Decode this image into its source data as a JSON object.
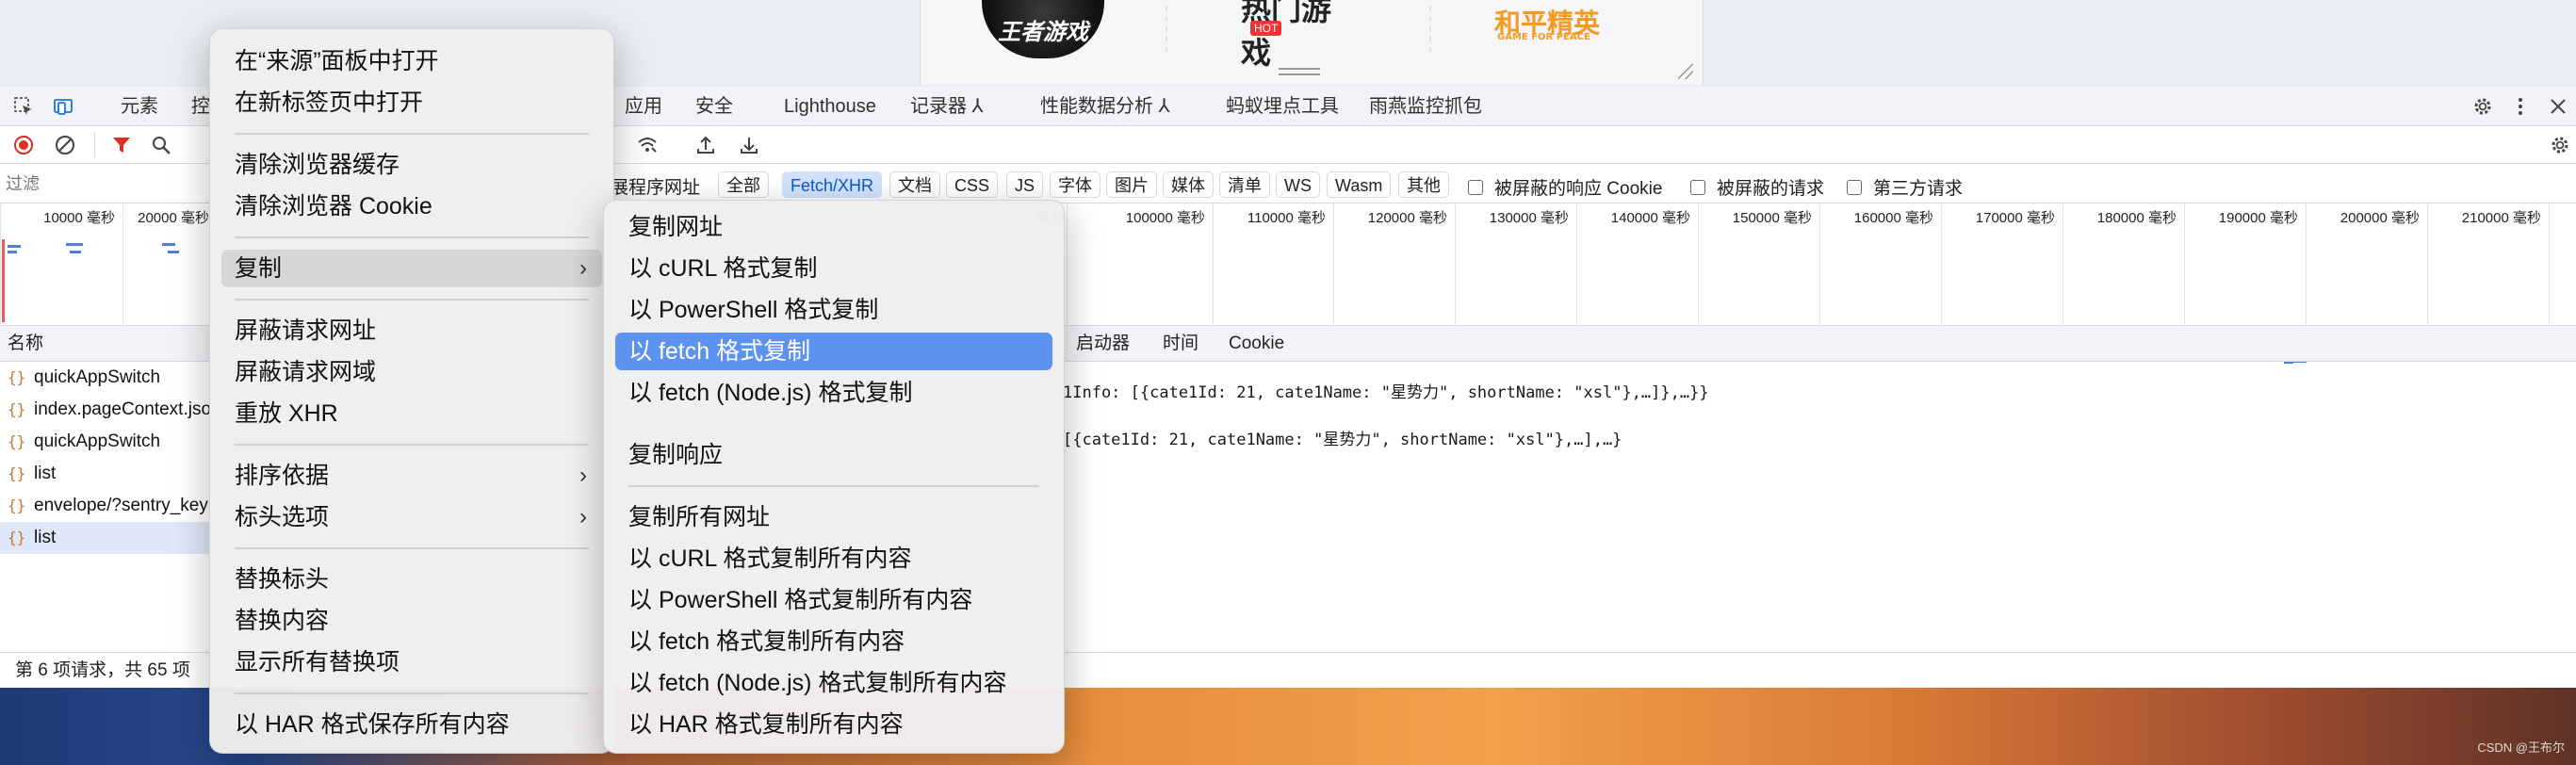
{
  "banner": {
    "logo1": "王者游戏",
    "logo2": "热门游戏",
    "hot_badge": "HOT",
    "logo3": "和平精英",
    "logo3_sub": "GAME FOR PEACE"
  },
  "devtools": {
    "tabs": [
      "元素",
      "控",
      "应用",
      "安全",
      "Lighthouse",
      "记录器 ⅄",
      "性能数据分析 ⅄",
      "蚂蚁埋点工具",
      "雨燕监控抓包"
    ],
    "filter_placeholder": "过滤",
    "partial_label": "展程序网址",
    "type_filters": [
      "全部",
      "Fetch/XHR",
      "文档",
      "CSS",
      "JS",
      "字体",
      "图片",
      "媒体",
      "清单",
      "WS",
      "Wasm",
      "其他"
    ],
    "active_filter": "Fetch/XHR",
    "checkboxes": [
      "被屏蔽的响应 Cookie",
      "被屏蔽的请求",
      "第三方请求"
    ],
    "timeline_ticks": [
      "10000 毫秒",
      "20000 毫秒",
      "100000 毫秒",
      "110000 毫秒",
      "120000 毫秒",
      "130000 毫秒",
      "140000 毫秒",
      "150000 毫秒",
      "160000 毫秒",
      "170000 毫秒",
      "180000 毫秒",
      "190000 毫秒",
      "200000 毫秒",
      "210000 毫秒"
    ],
    "tick_partial": "毫秒",
    "column_name": "名称",
    "detail_tabs": [
      "启动器",
      "时间",
      "Cookie"
    ],
    "requests": [
      "quickAppSwitch",
      "index.pageContext.json",
      "quickAppSwitch",
      "list",
      "envelope/?sentry_key",
      "list"
    ],
    "selected_request_index": 5,
    "response_lines": [
      "1Info: [{cate1Id: 21, cate1Name: \"星势力\", shortName: \"xsl\"},…]},…}}",
      "[{cate1Id: 21, cate1Name: \"星势力\", shortName: \"xsl\"},…],…}"
    ],
    "status": "第 6 项请求，共 65 项"
  },
  "context_menu": {
    "items": [
      "在“来源”面板中打开",
      "在新标签页中打开",
      "清除浏览器缓存",
      "清除浏览器 Cookie",
      "复制",
      "屏蔽请求网址",
      "屏蔽请求网域",
      "重放 XHR",
      "排序依据",
      "标头选项",
      "替换标头",
      "替换内容",
      "显示所有替换项",
      "以 HAR 格式保存所有内容"
    ]
  },
  "copy_submenu": {
    "items": [
      "复制网址",
      "以 cURL 格式复制",
      "以 PowerShell 格式复制",
      "以 fetch 格式复制",
      "以 fetch (Node.js) 格式复制",
      "复制响应",
      "复制所有网址",
      "以 cURL 格式复制所有内容",
      "以 PowerShell 格式复制所有内容",
      "以 fetch 格式复制所有内容",
      "以 fetch (Node.js) 格式复制所有内容",
      "以 HAR 格式复制所有内容"
    ],
    "highlighted": "以 fetch 格式复制"
  },
  "watermark": "CSDN @王布尔",
  "colors": {
    "accent": "#5c93f0",
    "record": "#d93025",
    "filter_active": "#d3e3fd"
  }
}
